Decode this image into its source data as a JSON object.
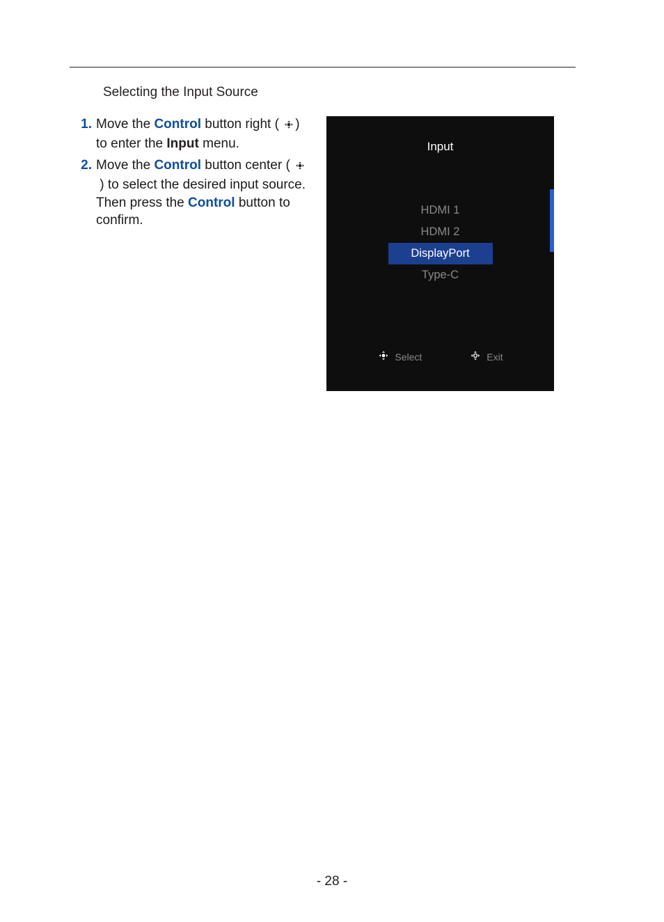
{
  "heading": "Selecting the Input Source",
  "steps": [
    {
      "num": "1.",
      "pre": "Move the ",
      "control": "Control",
      "mid1": " button right ( ",
      "mid2": ") to enter the ",
      "input": "Input",
      "post": " menu."
    },
    {
      "num": "2.",
      "pre": "Move the ",
      "control": "Control",
      "mid1": " button center ( ",
      "mid2": " ) to select the desired input source. Then press the ",
      "control2": "Control",
      "post": " button to confirm."
    }
  ],
  "osd": {
    "title": "Input",
    "items": [
      "HDMI 1",
      "HDMI 2",
      "DisplayPort",
      "Type-C"
    ],
    "selected_index": 2,
    "footer": {
      "select": "Select",
      "exit": "Exit"
    }
  },
  "page_number": "- 28 -"
}
